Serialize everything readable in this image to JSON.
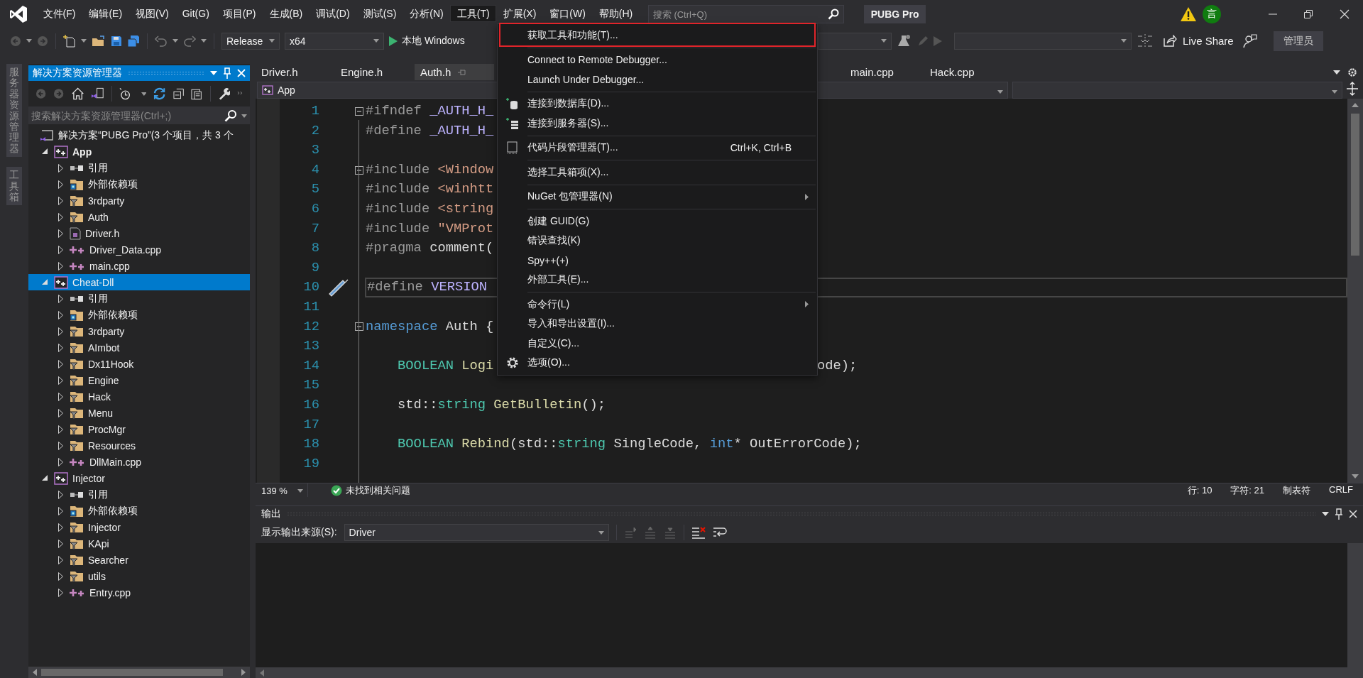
{
  "menubar": {
    "items": [
      {
        "label": "文件(F)",
        "selected": false
      },
      {
        "label": "编辑(E)",
        "selected": false
      },
      {
        "label": "视图(V)",
        "selected": false
      },
      {
        "label": "Git(G)",
        "selected": false
      },
      {
        "label": "项目(P)",
        "selected": false
      },
      {
        "label": "生成(B)",
        "selected": false
      },
      {
        "label": "调试(D)",
        "selected": false
      },
      {
        "label": "测试(S)",
        "selected": false
      },
      {
        "label": "分析(N)",
        "selected": false
      },
      {
        "label": "工具(T)",
        "selected": true
      },
      {
        "label": "扩展(X)",
        "selected": false
      },
      {
        "label": "窗口(W)",
        "selected": false
      },
      {
        "label": "帮助(H)",
        "selected": false
      }
    ]
  },
  "search": {
    "placeholder": "搜索 (Ctrl+Q)"
  },
  "window": {
    "title": "PUBG Pro"
  },
  "account": {
    "initial": "言"
  },
  "toolbar": {
    "configuration": "Release",
    "platform": "x64",
    "run_target": "本地 Windows",
    "live_share": "Live Share",
    "admin": "管理员"
  },
  "side_tabs": [
    "服务器资源管理器",
    "工具箱"
  ],
  "solution_explorer": {
    "title": "解决方案资源管理器",
    "search_placeholder": "搜索解决方案资源管理器(Ctrl+;)",
    "tree": [
      {
        "label": "解决方案“PUBG Pro”(3 个项目，共 3 个",
        "kind": "solution",
        "selected": false,
        "children": [
          {
            "label": "App",
            "kind": "project",
            "startup": true,
            "selected": false,
            "expanded": true,
            "children": [
              {
                "label": "引用",
                "kind": "references",
                "selected": false,
                "expanded": false
              },
              {
                "label": "外部依赖项",
                "kind": "external",
                "selected": false,
                "expanded": false
              },
              {
                "label": "3rdparty",
                "kind": "filter",
                "selected": false,
                "expanded": false
              },
              {
                "label": "Auth",
                "kind": "filter",
                "selected": false,
                "expanded": false
              },
              {
                "label": "Driver.h",
                "kind": "header",
                "selected": false,
                "expanded": false
              },
              {
                "label": "Driver_Data.cpp",
                "kind": "source",
                "selected": false,
                "expanded": false
              },
              {
                "label": "main.cpp",
                "kind": "source",
                "selected": false,
                "expanded": false
              }
            ]
          },
          {
            "label": "Cheat-Dll",
            "kind": "project",
            "startup": false,
            "selected": true,
            "expanded": true,
            "children": [
              {
                "label": "引用",
                "kind": "references",
                "selected": false,
                "expanded": false
              },
              {
                "label": "外部依赖项",
                "kind": "external",
                "selected": false,
                "expanded": false
              },
              {
                "label": "3rdparty",
                "kind": "filter",
                "selected": false,
                "expanded": false
              },
              {
                "label": "AImbot",
                "kind": "filter",
                "selected": false,
                "expanded": false
              },
              {
                "label": "Dx11Hook",
                "kind": "filter",
                "selected": false,
                "expanded": false
              },
              {
                "label": "Engine",
                "kind": "filter",
                "selected": false,
                "expanded": false
              },
              {
                "label": "Hack",
                "kind": "filter",
                "selected": false,
                "expanded": false
              },
              {
                "label": "Menu",
                "kind": "filter",
                "selected": false,
                "expanded": false
              },
              {
                "label": "ProcMgr",
                "kind": "filter",
                "selected": false,
                "expanded": false
              },
              {
                "label": "Resources",
                "kind": "filter",
                "selected": false,
                "expanded": false
              },
              {
                "label": "DllMain.cpp",
                "kind": "source",
                "selected": false,
                "expanded": false
              }
            ]
          },
          {
            "label": "Injector",
            "kind": "project",
            "startup": false,
            "selected": false,
            "expanded": true,
            "children": [
              {
                "label": "引用",
                "kind": "references",
                "selected": false,
                "expanded": false
              },
              {
                "label": "外部依赖项",
                "kind": "external",
                "selected": false,
                "expanded": false
              },
              {
                "label": "Injector",
                "kind": "filter",
                "selected": false,
                "expanded": false
              },
              {
                "label": "KApi",
                "kind": "filter",
                "selected": false,
                "expanded": false
              },
              {
                "label": "Searcher",
                "kind": "filter",
                "selected": false,
                "expanded": false
              },
              {
                "label": "utils",
                "kind": "filter",
                "selected": false,
                "expanded": false
              },
              {
                "label": "Entry.cpp",
                "kind": "source",
                "selected": false,
                "expanded": false
              }
            ]
          }
        ]
      }
    ]
  },
  "editor": {
    "tabs": [
      {
        "label": "Driver.h",
        "selected": false
      },
      {
        "label": "Engine.h",
        "selected": false
      },
      {
        "label": "Auth.h",
        "selected": true
      },
      {
        "label": "main.cpp",
        "selected": false
      },
      {
        "label": "Hack.cpp",
        "selected": false
      }
    ],
    "project": "App",
    "lines": [
      {
        "number": "1",
        "fold": true,
        "tokens": [
          {
            "kind": "pp",
            "text": "#ifndef "
          },
          {
            "kind": "macro",
            "text": "_AUTH_H_"
          }
        ]
      },
      {
        "number": "2",
        "fold": false,
        "tokens": [
          {
            "kind": "pp",
            "text": "#define "
          },
          {
            "kind": "macro",
            "text": "_AUTH_H_"
          }
        ]
      },
      {
        "number": "3",
        "fold": false
      },
      {
        "number": "4",
        "fold": true,
        "tokens": [
          {
            "kind": "pp",
            "text": "#include "
          },
          {
            "kind": "str",
            "text": "<Window"
          }
        ]
      },
      {
        "number": "5",
        "fold": false,
        "tokens": [
          {
            "kind": "pp",
            "text": "#include "
          },
          {
            "kind": "str",
            "text": "<winhtt"
          }
        ]
      },
      {
        "number": "6",
        "fold": false,
        "tokens": [
          {
            "kind": "pp",
            "text": "#include "
          },
          {
            "kind": "str",
            "text": "<string"
          }
        ]
      },
      {
        "number": "7",
        "fold": false,
        "tokens": [
          {
            "kind": "pp",
            "text": "#include "
          },
          {
            "kind": "str",
            "text": "\"VMProt"
          }
        ]
      },
      {
        "number": "8",
        "fold": false,
        "tokens": [
          {
            "kind": "pp",
            "text": "#pragma"
          },
          {
            "kind": "plain",
            "text": " comment("
          }
        ]
      },
      {
        "number": "9",
        "fold": false
      },
      {
        "number": "10",
        "fold": false,
        "current": true,
        "quick_action": true,
        "tokens": [
          {
            "kind": "pp",
            "text": "#define "
          },
          {
            "kind": "macro",
            "text": "VERSION"
          }
        ]
      },
      {
        "number": "11",
        "fold": false
      },
      {
        "number": "12",
        "fold": true,
        "tokens": [
          {
            "kind": "kw",
            "text": "namespace"
          },
          {
            "kind": "plain",
            "text": " Auth {"
          }
        ]
      },
      {
        "number": "13",
        "fold": false
      },
      {
        "number": "14",
        "fold": false,
        "tokens": [
          {
            "kind": "type",
            "text": "    BOOLEAN "
          },
          {
            "kind": "fn",
            "text": "Logi"
          }
        ],
        "tail": [
          {
            "kind": "plain",
            "text": "ode);"
          }
        ]
      },
      {
        "number": "15",
        "fold": false
      },
      {
        "number": "16",
        "fold": false,
        "tokens": [
          {
            "kind": "plain",
            "text": "    std::"
          },
          {
            "kind": "type",
            "text": "string "
          },
          {
            "kind": "fn",
            "text": "GetBulletin"
          },
          {
            "kind": "plain",
            "text": "();"
          }
        ]
      },
      {
        "number": "17",
        "fold": false
      },
      {
        "number": "18",
        "fold": false,
        "tokens": [
          {
            "kind": "type",
            "text": "    BOOLEAN "
          },
          {
            "kind": "fn",
            "text": "Rebind"
          },
          {
            "kind": "plain",
            "text": "(std::"
          },
          {
            "kind": "type",
            "text": "string"
          },
          {
            "kind": "plain",
            "text": " SingleCode, "
          },
          {
            "kind": "kw",
            "text": "int"
          },
          {
            "kind": "plain",
            "text": "* OutErrorCode);"
          }
        ]
      },
      {
        "number": "19",
        "fold": false
      }
    ],
    "status": {
      "zoom": "139 %",
      "issues": "未找到相关问题",
      "line": "行: 10",
      "column": "字符: 21",
      "indent": "制表符",
      "eol": "CRLF"
    }
  },
  "output": {
    "title": "输出",
    "source_label": "显示输出来源(S):",
    "source": "Driver"
  },
  "tools_menu": {
    "items": [
      {
        "kind": "plain",
        "label": "获取工具和功能(T)...",
        "annotated": true
      },
      {
        "kind": "separator"
      },
      {
        "kind": "plain",
        "label": "Connect to Remote Debugger..."
      },
      {
        "kind": "plain",
        "label": "Launch Under Debugger..."
      },
      {
        "kind": "separator"
      },
      {
        "kind": "database",
        "label": "连接到数据库(D)..."
      },
      {
        "kind": "server",
        "label": "连接到服务器(S)..."
      },
      {
        "kind": "separator"
      },
      {
        "kind": "snippet",
        "label": "代码片段管理器(T)...",
        "shortcut": "Ctrl+K, Ctrl+B"
      },
      {
        "kind": "separator"
      },
      {
        "kind": "plain",
        "label": "选择工具箱项(X)..."
      },
      {
        "kind": "separator"
      },
      {
        "kind": "submenu",
        "label": "NuGet 包管理器(N)"
      },
      {
        "kind": "separator"
      },
      {
        "kind": "plain",
        "label": "创建 GUID(G)"
      },
      {
        "kind": "plain",
        "label": "错误查找(K)"
      },
      {
        "kind": "plain",
        "label": "Spy++(+)"
      },
      {
        "kind": "plain",
        "label": "外部工具(E)..."
      },
      {
        "kind": "separator"
      },
      {
        "kind": "submenu",
        "label": "命令行(L)"
      },
      {
        "kind": "plain",
        "label": "导入和导出设置(I)..."
      },
      {
        "kind": "plain",
        "label": "自定义(C)..."
      },
      {
        "kind": "settings",
        "label": "选项(O)..."
      }
    ]
  }
}
